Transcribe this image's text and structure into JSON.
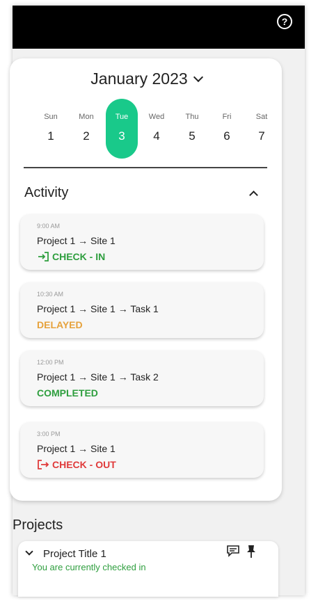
{
  "header": {
    "help_icon": "help-circle-icon",
    "help_symbol": "?"
  },
  "calendar": {
    "month_label": "January 2023",
    "days": [
      {
        "name": "Sun",
        "date": "1"
      },
      {
        "name": "Mon",
        "date": "2"
      },
      {
        "name": "Tue",
        "date": "3"
      },
      {
        "name": "Wed",
        "date": "4"
      },
      {
        "name": "Thu",
        "date": "5"
      },
      {
        "name": "Fri",
        "date": "6"
      },
      {
        "name": "Sat",
        "date": "7"
      }
    ],
    "selected_day": "Tue",
    "accent_color": "#19c98a"
  },
  "activity": {
    "title": "Activity",
    "items": [
      {
        "time": "9:00 AM",
        "path": "Project 1 → Site 1",
        "status": "CHECK - IN",
        "status_icon": "check-in-icon",
        "status_color": "#2e9e3e"
      },
      {
        "time": "10:30 AM",
        "path": "Project 1 → Site 1 → Task 1",
        "status": "DELAYED",
        "status_color": "#e6a23c"
      },
      {
        "time": "12:00 PM",
        "path": "Project 1 → Site 1 → Task 2",
        "status": "COMPLETED",
        "status_color": "#2e9e3e"
      },
      {
        "time": "3:00 PM",
        "path": "Project 1 → Site 1",
        "status": "CHECK - OUT",
        "status_icon": "check-out-icon",
        "status_color": "#e03b3b"
      }
    ]
  },
  "projects": {
    "title": "Projects",
    "items": [
      {
        "title": "Project Title 1",
        "subtitle": "You are currently checked in",
        "icons": [
          "chat-icon",
          "pin-icon"
        ]
      }
    ]
  }
}
